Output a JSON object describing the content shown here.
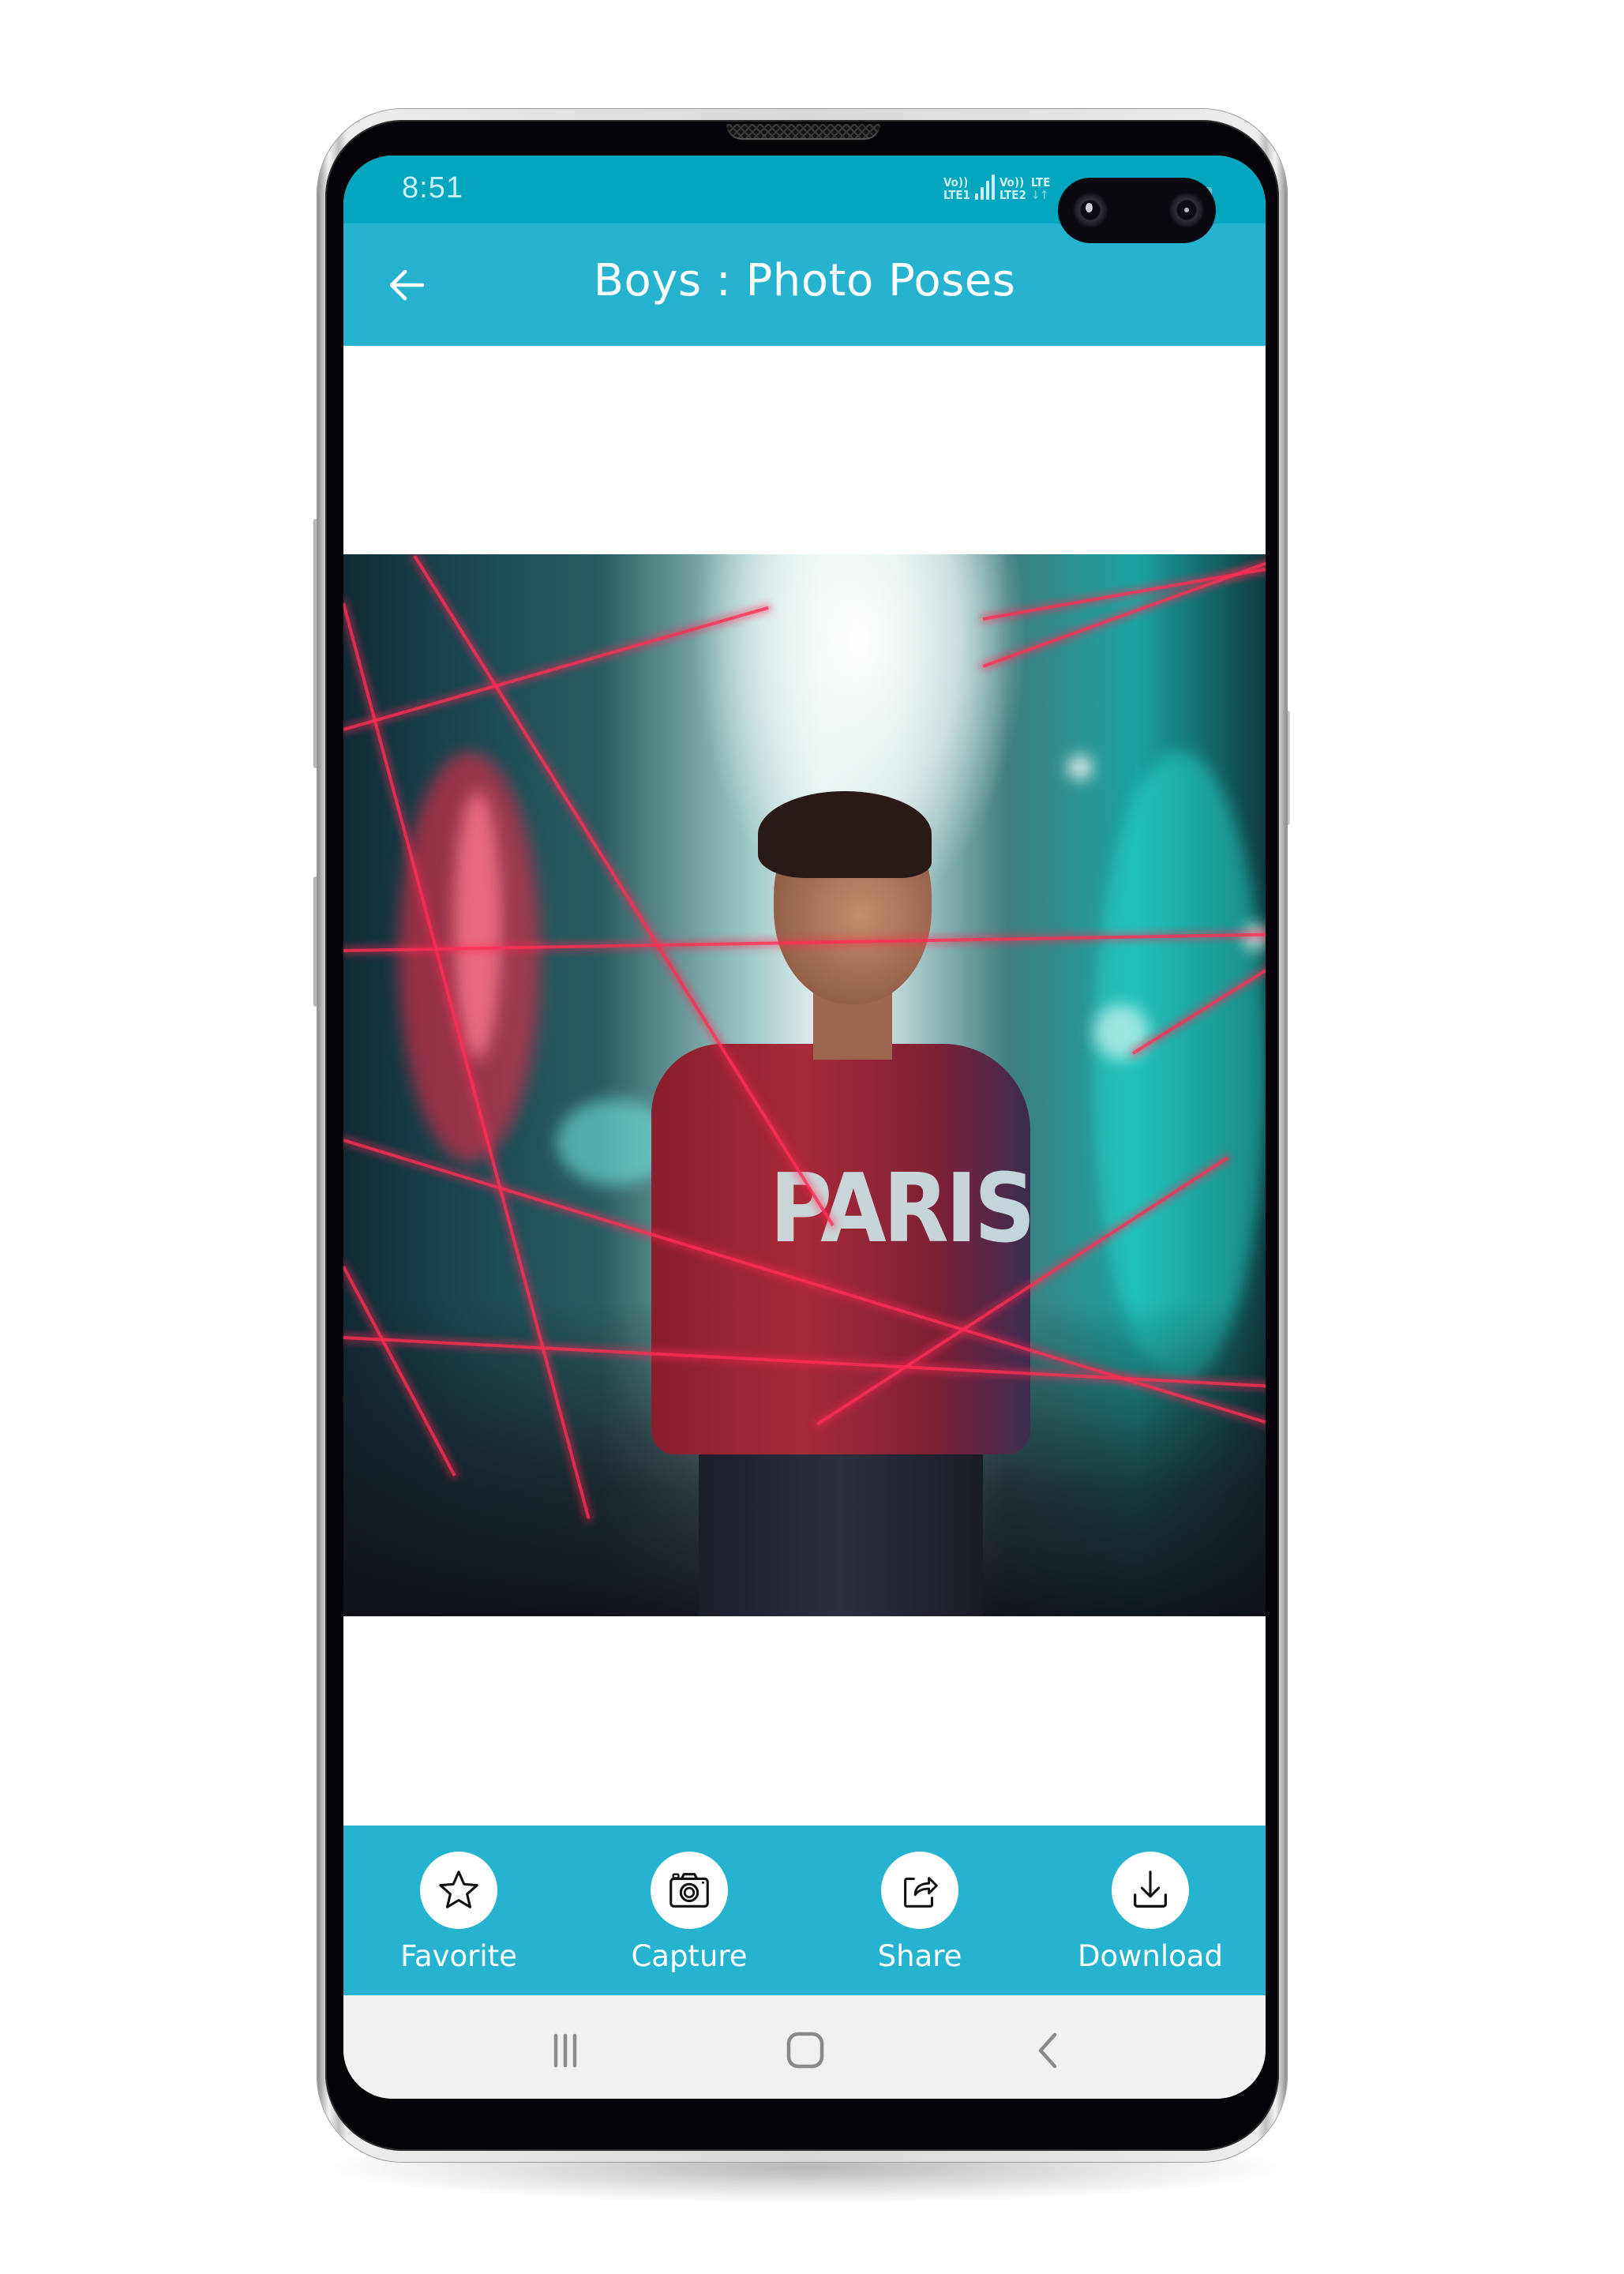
{
  "status_bar": {
    "time": "8:51",
    "sim1_label_top": "Vo))",
    "sim1_label_bottom": "LTE1",
    "sim2_label_top": "Vo))",
    "sim2_label_bottom": "LTE2",
    "network_label": "LTE",
    "data_arrows": "↓↑"
  },
  "app_bar": {
    "back_icon": "arrow-left-icon",
    "title": "Boys : Photo Poses"
  },
  "photo": {
    "description": "Young man in red PARIS sweatshirt posing in neon city street with red laser lines",
    "shirt_text": "PARIS"
  },
  "actions": [
    {
      "id": "favorite",
      "label": "Favorite",
      "icon": "star-outline-icon"
    },
    {
      "id": "capture",
      "label": "Capture",
      "icon": "camera-icon"
    },
    {
      "id": "share",
      "label": "Share",
      "icon": "share-icon"
    },
    {
      "id": "download",
      "label": "Download",
      "icon": "download-icon"
    }
  ],
  "nav_bar": {
    "recents_icon": "recents-icon",
    "home_icon": "home-icon",
    "back_icon": "back-chevron-icon"
  },
  "colors": {
    "status_bar": "#02a6be",
    "app_bar": "#25b3cf",
    "action_bar": "#25b3cf",
    "nav_bar": "#f1f1f1",
    "nav_icon": "#888888"
  }
}
